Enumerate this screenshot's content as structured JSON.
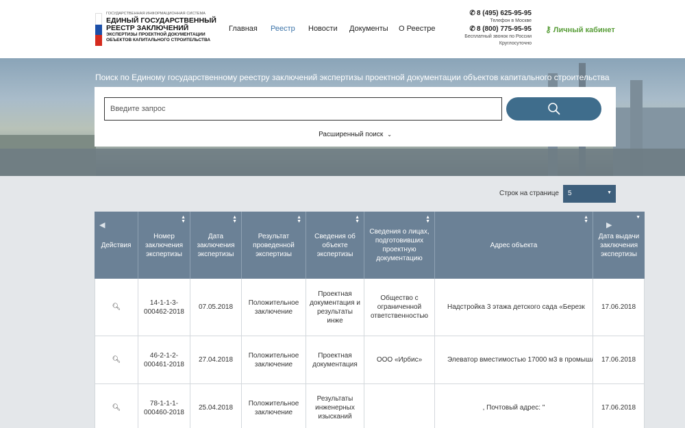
{
  "header": {
    "logo": {
      "line1": "ГОСУДАРСТВЕННАЯ ИНФОРМАЦИОННАЯ СИСТЕМА",
      "line2": "ЕДИНЫЙ ГОСУДАРСТВЕННЫЙ",
      "line3": "РЕЕСТР ЗАКЛЮЧЕНИЙ",
      "line4": "ЭКСПЕРТИЗЫ ПРОЕКТНОЙ ДОКУМЕНТАЦИИ",
      "line5": "ОБЪЕКТОВ КАПИТАЛЬНОГО СТРОИТЕЛЬСТВА",
      "flag_colors": [
        "#ffffff",
        "#1c4fa8",
        "#d52b1e"
      ]
    },
    "nav": [
      {
        "label": "Главная",
        "active": false
      },
      {
        "label": "Реестр",
        "active": true
      },
      {
        "label": "Новости",
        "active": false
      },
      {
        "label": "Документы",
        "active": false
      },
      {
        "label": "О Реестре",
        "active": false
      }
    ],
    "contacts": {
      "phone1": "8 (495) 625-95-95",
      "phone1_note": "Телефон в Москве",
      "phone2": "8 (800) 775-95-95",
      "phone2_note1": "Бесплатный звонок по России",
      "phone2_note2": "Круглосуточно"
    },
    "cabinet_label": "Личный кабинет"
  },
  "search": {
    "title": "Поиск по Единому государственному реестру заключений экспертизы проектной документации объектов капитального строительства",
    "placeholder": "Введите запрос",
    "value": "",
    "advanced_label": "Расширенный поиск"
  },
  "pagination": {
    "rows_label": "Строк на странице",
    "rows_value": "5"
  },
  "table": {
    "headers": [
      "Действия",
      "Номер заключения экспертизы",
      "Дата заключения экспертизы",
      "Результат проведенной экспертизы",
      "Сведения об объекте экспертизы",
      "Сведения о лицах, подготовивших проектную документацию",
      "Адрес объекта",
      "Дата выдачи заключения экспертизы"
    ],
    "rows": [
      {
        "number": "14-1-1-3-000462-2018",
        "date": "07.05.2018",
        "result": "Положительное заключение",
        "object": "Проектная документация и результаты инже",
        "persons": "Общество с ограниченной ответственностью",
        "address": "Надстройка 3 этажа детского сада «Березк",
        "issue_date": "17.06.2018"
      },
      {
        "number": "46-2-1-2-000461-2018",
        "date": "27.04.2018",
        "result": "Положительное заключение",
        "object": "Проектная документация",
        "persons": "ООО «Ирбис»",
        "address": "Элеватор вместимостью 17000 м3 в промышл",
        "issue_date": "17.06.2018"
      },
      {
        "number": "78-1-1-1-000460-2018",
        "date": "25.04.2018",
        "result": "Положительное заключение",
        "object": "Результаты инженерных изысканий",
        "persons": "",
        "address": ", Почтовый адрес: \"",
        "issue_date": "17.06.2018"
      }
    ]
  }
}
